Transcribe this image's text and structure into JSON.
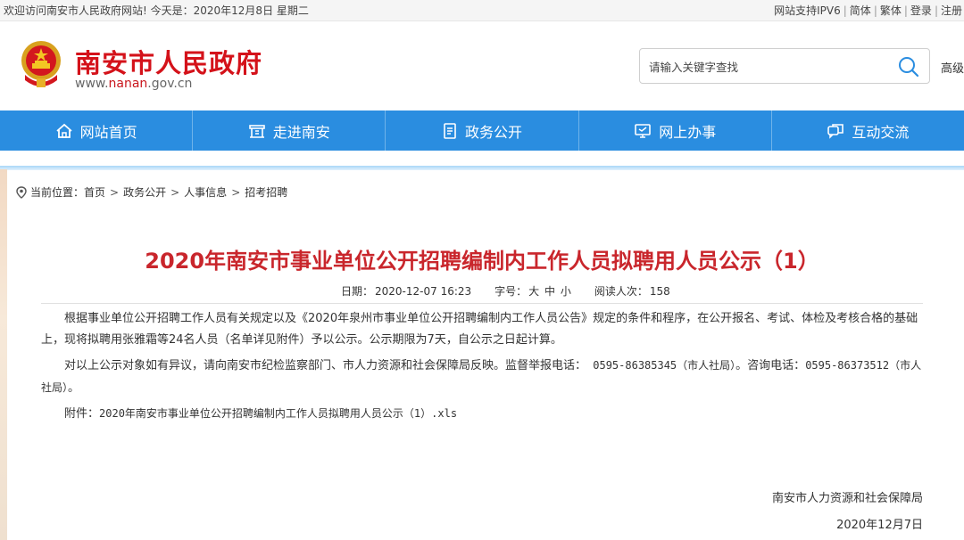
{
  "topbar": {
    "welcome": "欢迎访问南安市人民政府网站! 今天是：2020年12月8日 星期二",
    "links": [
      "网站支持IPV6",
      "简体",
      "繁体",
      "登录",
      "注册"
    ]
  },
  "header": {
    "site_name": "南安市人民政府",
    "url_prefix": "www.",
    "url_domain": "nanan",
    "url_suffix": ".gov.cn",
    "search_placeholder": "请输入关键字查找",
    "advanced": "高级"
  },
  "nav": {
    "items": [
      {
        "label": "网站首页",
        "icon": "home-icon"
      },
      {
        "label": "走进南安",
        "icon": "building-icon"
      },
      {
        "label": "政务公开",
        "icon": "document-icon"
      },
      {
        "label": "网上办事",
        "icon": "monitor-icon"
      },
      {
        "label": "互动交流",
        "icon": "chat-icon"
      }
    ]
  },
  "breadcrumb": {
    "prefix": "当前位置：",
    "items": [
      "首页",
      "政务公开",
      "人事信息",
      "招考招聘"
    ]
  },
  "article": {
    "title": "2020年南安市事业单位公开招聘编制内工作人员拟聘用人员公示（1）",
    "date_label": "日期：",
    "date": "2020-12-07 16:23",
    "font_label": "字号：",
    "font_sizes": [
      "大",
      "中",
      "小"
    ],
    "views_label": "阅读人次：",
    "views": "158",
    "paragraph1": "根据事业单位公开招聘工作人员有关规定以及《2020年泉州市事业单位公开招聘编制内工作人员公告》规定的条件和程序，在公开报名、考试、体检及考核合格的基础上，现将拟聘用张雅霜等24名人员（名单详见附件）予以公示。公示期限为7天，自公示之日起计算。",
    "paragraph2_a": "对以上公示对象如有异议，请向南安市纪检监察部门、市人力资源和社会保障局反映。监督举报电话：",
    "paragraph2_phone1": " 0595-86385345（市人社局）",
    "paragraph2_b": "。咨询电话：",
    "paragraph2_phone2": "0595-86373512（市人社局）",
    "paragraph2_end": "。",
    "attachment_label": "附件：",
    "attachment_name": "2020年南安市事业单位公开招聘编制内工作人员拟聘用人员公示（1）.xls",
    "sign_org": "南安市人力资源和社会保障局",
    "sign_date": "2020年12月7日"
  },
  "colors": {
    "nav_bg": "#2a8de0",
    "title_red": "#c9262c",
    "site_red": "#d4121a"
  }
}
